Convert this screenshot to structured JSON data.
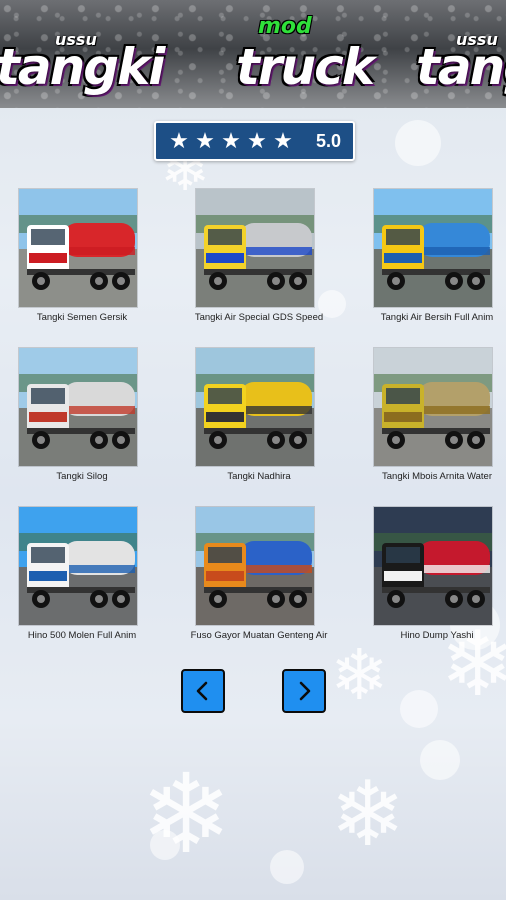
{
  "banner": {
    "brand_left_small": "ussu",
    "brand_left": "tangki",
    "brand_center_small": "mod",
    "brand_center": "truck",
    "brand_right_small": "ussu",
    "brand_right": "tang"
  },
  "rating": {
    "stars": 5,
    "score": "5.0"
  },
  "grid": {
    "items": [
      {
        "label": "Tangki Semen Gersik",
        "palette": {
          "sky": "#8fc4ea",
          "ground": "#8d8f8a",
          "cab": "#ffffff",
          "body": "#d8262a",
          "accent": "#cc1c22"
        }
      },
      {
        "label": "Tangki Air Special GDS Speed",
        "palette": {
          "sky": "#b9c3c9",
          "ground": "#7b7f7a",
          "cab": "#f3d22a",
          "body": "#c7c9cc",
          "accent": "#1d48c8"
        }
      },
      {
        "label": "Tangki Air Bersih Full Anim",
        "palette": {
          "sky": "#7fc0ee",
          "ground": "#6d7570",
          "cab": "#f5c814",
          "body": "#3588d8",
          "accent": "#1d5fb0"
        }
      },
      {
        "label": "Tangki Silog",
        "palette": {
          "sky": "#9fcbe8",
          "ground": "#7a7d79",
          "cab": "#e8e8e8",
          "body": "#d9d9d9",
          "accent": "#c0392b"
        }
      },
      {
        "label": "Tangki Nadhira",
        "palette": {
          "sky": "#9ec6dd",
          "ground": "#6f726f",
          "cab": "#f2d21f",
          "body": "#e8c01a",
          "accent": "#333333"
        }
      },
      {
        "label": "Tangki Mbois Arnita Water",
        "palette": {
          "sky": "#c9d2d8",
          "ground": "#8a8a86",
          "cab": "#c9b22a",
          "body": "#b3a06a",
          "accent": "#8c6d1f"
        }
      },
      {
        "label": "Hino 500 Molen Full Anim",
        "palette": {
          "sky": "#3ea2ee",
          "ground": "#6b6d6e",
          "cab": "#f4f4f4",
          "body": "#e3e3e3",
          "accent": "#1d5fb0"
        }
      },
      {
        "label": "Fuso Gayor Muatan Genteng Air",
        "palette": {
          "sky": "#99c6e6",
          "ground": "#6e6a66",
          "cab": "#e88a1c",
          "body": "#2b62c8",
          "accent": "#c84b1c"
        }
      },
      {
        "label": "Hino Dump Yashi",
        "palette": {
          "sky": "#2e3c52",
          "ground": "#4a4d52",
          "cab": "#1a1a1a",
          "body": "#c5192d",
          "accent": "#f2f2f2"
        }
      }
    ]
  },
  "nav": {
    "prev_icon": "chevron-left-icon",
    "next_icon": "chevron-right-icon"
  }
}
